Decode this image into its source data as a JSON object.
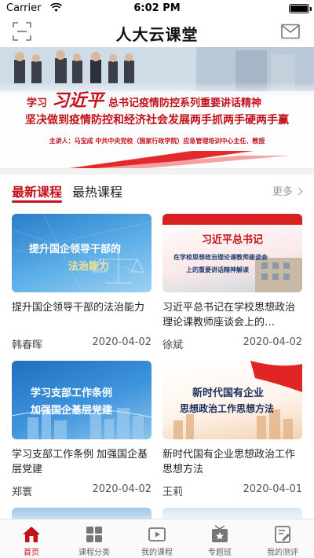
{
  "status_bar": {
    "carrier": "Carrier",
    "time": "6:02 PM"
  },
  "nav": {
    "title": "人大云课堂"
  },
  "banner": {
    "prefix": "学习",
    "name": "习近平",
    "suffix": "总书记疫情防控系列重要讲话精神",
    "line2": "坚决做到疫情防控和经济社会发展两手抓两手硬两手赢",
    "line3": "主讲人：马宝成 中共中央党校（国家行政学院）应急管理培训中心主任、教授"
  },
  "tabs": {
    "latest": "最新课程",
    "hot": "最热课程",
    "more": "更多"
  },
  "courses": [
    {
      "thumb_lines": [
        "提升国企领导干部的",
        "法治能力"
      ],
      "title": "提升国企领导干部的法治能力",
      "author": "韩春晖",
      "date": "2020-04-02"
    },
    {
      "thumb_lines": [
        "习近平总书记",
        "在学校思想政治理论课教师座谈会",
        "上的重要讲话精神解读"
      ],
      "title": "习近平总书记在学校思想政治理论课教师座谈会上的…",
      "author": "徐斌",
      "date": "2020-04-02"
    },
    {
      "thumb_lines": [
        "学习支部工作条例",
        "加强国企基层党建"
      ],
      "title": "学习支部工作条例 加强国企基层党建",
      "author": "郑寰",
      "date": "2020-04-02"
    },
    {
      "thumb_lines": [
        "新时代国有企业",
        "思想政治工作思想方法"
      ],
      "title": "新时代国有企业思想政治工作思想方法",
      "author": "王莉",
      "date": "2020-04-01"
    }
  ],
  "tab_bar": [
    {
      "label": "首页",
      "icon": "home-icon",
      "active": true
    },
    {
      "label": "课程分类",
      "icon": "grid-icon",
      "active": false
    },
    {
      "label": "我的课程",
      "icon": "play-icon",
      "active": false
    },
    {
      "label": "专题班",
      "icon": "star-board-icon",
      "active": false
    },
    {
      "label": "我的测评",
      "icon": "edit-note-icon",
      "active": false
    }
  ],
  "colors": {
    "accent": "#c4121c",
    "text": "#222222",
    "muted": "#999999"
  }
}
